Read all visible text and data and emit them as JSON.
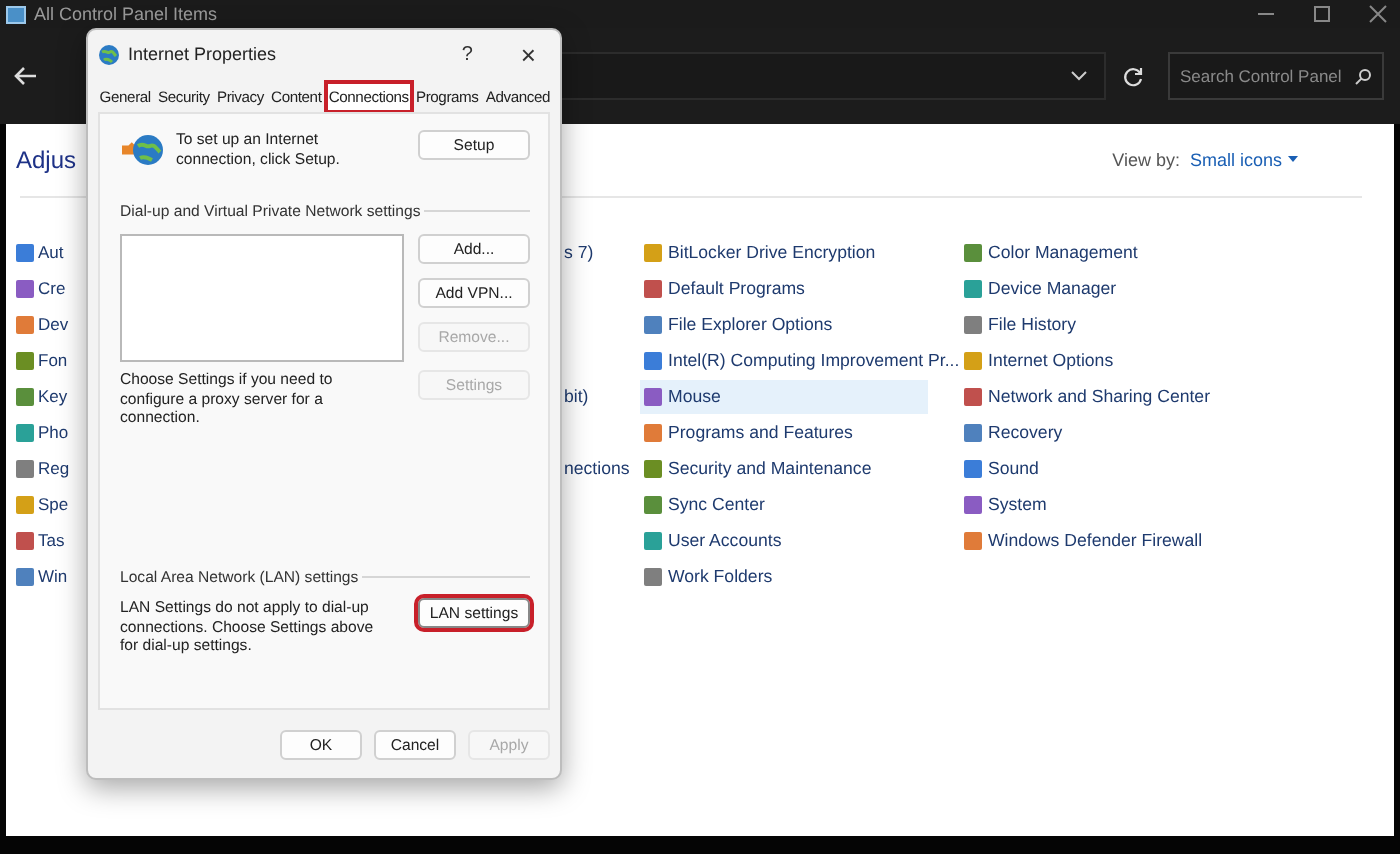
{
  "window": {
    "title": "All Control Panel Items"
  },
  "address_bar": {
    "search": {
      "placeholder": "Search Control Panel"
    }
  },
  "heading": "Adjus",
  "view_by": {
    "label": "View by:",
    "value": "Small icons"
  },
  "rows": [
    {
      "col1": {
        "label": "Aut",
        "selected": false
      },
      "col2": {
        "label": "s 7)"
      },
      "col3": {
        "label": "BitLocker Drive Encryption",
        "selected": false
      },
      "col4": {
        "label": "Color Management",
        "selected": false
      }
    },
    {
      "col1": {
        "label": "Cre",
        "selected": false
      },
      "col3": {
        "label": "Default Programs",
        "selected": false
      },
      "col4": {
        "label": "Device Manager",
        "selected": false
      }
    },
    {
      "col1": {
        "label": "Dev",
        "selected": false
      },
      "col3": {
        "label": "File Explorer Options",
        "selected": false
      },
      "col4": {
        "label": "File History",
        "selected": false
      }
    },
    {
      "col1": {
        "label": "Fon",
        "selected": false
      },
      "col3": {
        "label": "Intel(R) Computing Improvement Pr...",
        "selected": false
      },
      "col4": {
        "label": "Internet Options",
        "selected": false
      }
    },
    {
      "col1": {
        "label": "Key",
        "selected": false
      },
      "col2": {
        "label": "bit)"
      },
      "col3": {
        "label": "Mouse",
        "selected": true
      },
      "col4": {
        "label": "Network and Sharing Center",
        "selected": false
      }
    },
    {
      "col1": {
        "label": "Pho",
        "selected": false
      },
      "col3": {
        "label": "Programs and Features",
        "selected": false
      },
      "col4": {
        "label": "Recovery",
        "selected": false
      }
    },
    {
      "col1": {
        "label": "Reg",
        "selected": false
      },
      "col2": {
        "label": "nections"
      },
      "col3": {
        "label": "Security and Maintenance",
        "selected": false
      },
      "col4": {
        "label": "Sound",
        "selected": false
      }
    },
    {
      "col1": {
        "label": "Spe",
        "selected": false
      },
      "col3": {
        "label": "Sync Center",
        "selected": false
      },
      "col4": {
        "label": "System",
        "selected": false
      }
    },
    {
      "col1": {
        "label": "Tas",
        "selected": false
      },
      "col3": {
        "label": "User Accounts",
        "selected": false
      },
      "col4": {
        "label": "Windows Defender Firewall",
        "selected": false
      }
    },
    {
      "col1": {
        "label": "Win",
        "selected": false
      },
      "col3": {
        "label": "Work Folders",
        "selected": false
      }
    }
  ],
  "dialog": {
    "title": "Internet Properties",
    "help": "?",
    "close": "×",
    "tabs": [
      {
        "label": "General",
        "selected": false,
        "highlighted": false
      },
      {
        "label": "Security",
        "selected": false,
        "highlighted": false
      },
      {
        "label": "Privacy",
        "selected": false,
        "highlighted": false
      },
      {
        "label": "Content",
        "selected": false,
        "highlighted": false
      },
      {
        "label": "Connections",
        "selected": true,
        "highlighted": true
      },
      {
        "label": "Programs",
        "selected": false,
        "highlighted": false
      },
      {
        "label": "Advanced",
        "selected": false,
        "highlighted": false
      }
    ],
    "setup_text": "To set up an Internet connection, click Setup.",
    "setup_button": {
      "label": "Setup",
      "disabled": false,
      "highlighted": false
    },
    "dialup_group": "Dial-up and Virtual Private Network settings",
    "dialup_buttons": [
      {
        "label": "Add...",
        "disabled": false
      },
      {
        "label": "Add VPN...",
        "disabled": false
      },
      {
        "label": "Remove...",
        "disabled": true
      }
    ],
    "proxy_text": "Choose Settings if you need to configure a proxy server for a connection.",
    "settings_button": {
      "label": "Settings",
      "disabled": true,
      "highlighted": false
    },
    "lan_group": "Local Area Network (LAN) settings",
    "lan_text": "LAN Settings do not apply to dial-up connections. Choose Settings above for dial-up settings.",
    "lan_button": {
      "label": "LAN settings",
      "disabled": false,
      "highlighted": true
    },
    "footer_buttons": [
      {
        "label": "OK",
        "disabled": false
      },
      {
        "label": "Cancel",
        "disabled": false
      },
      {
        "label": "Apply",
        "disabled": true
      }
    ]
  }
}
